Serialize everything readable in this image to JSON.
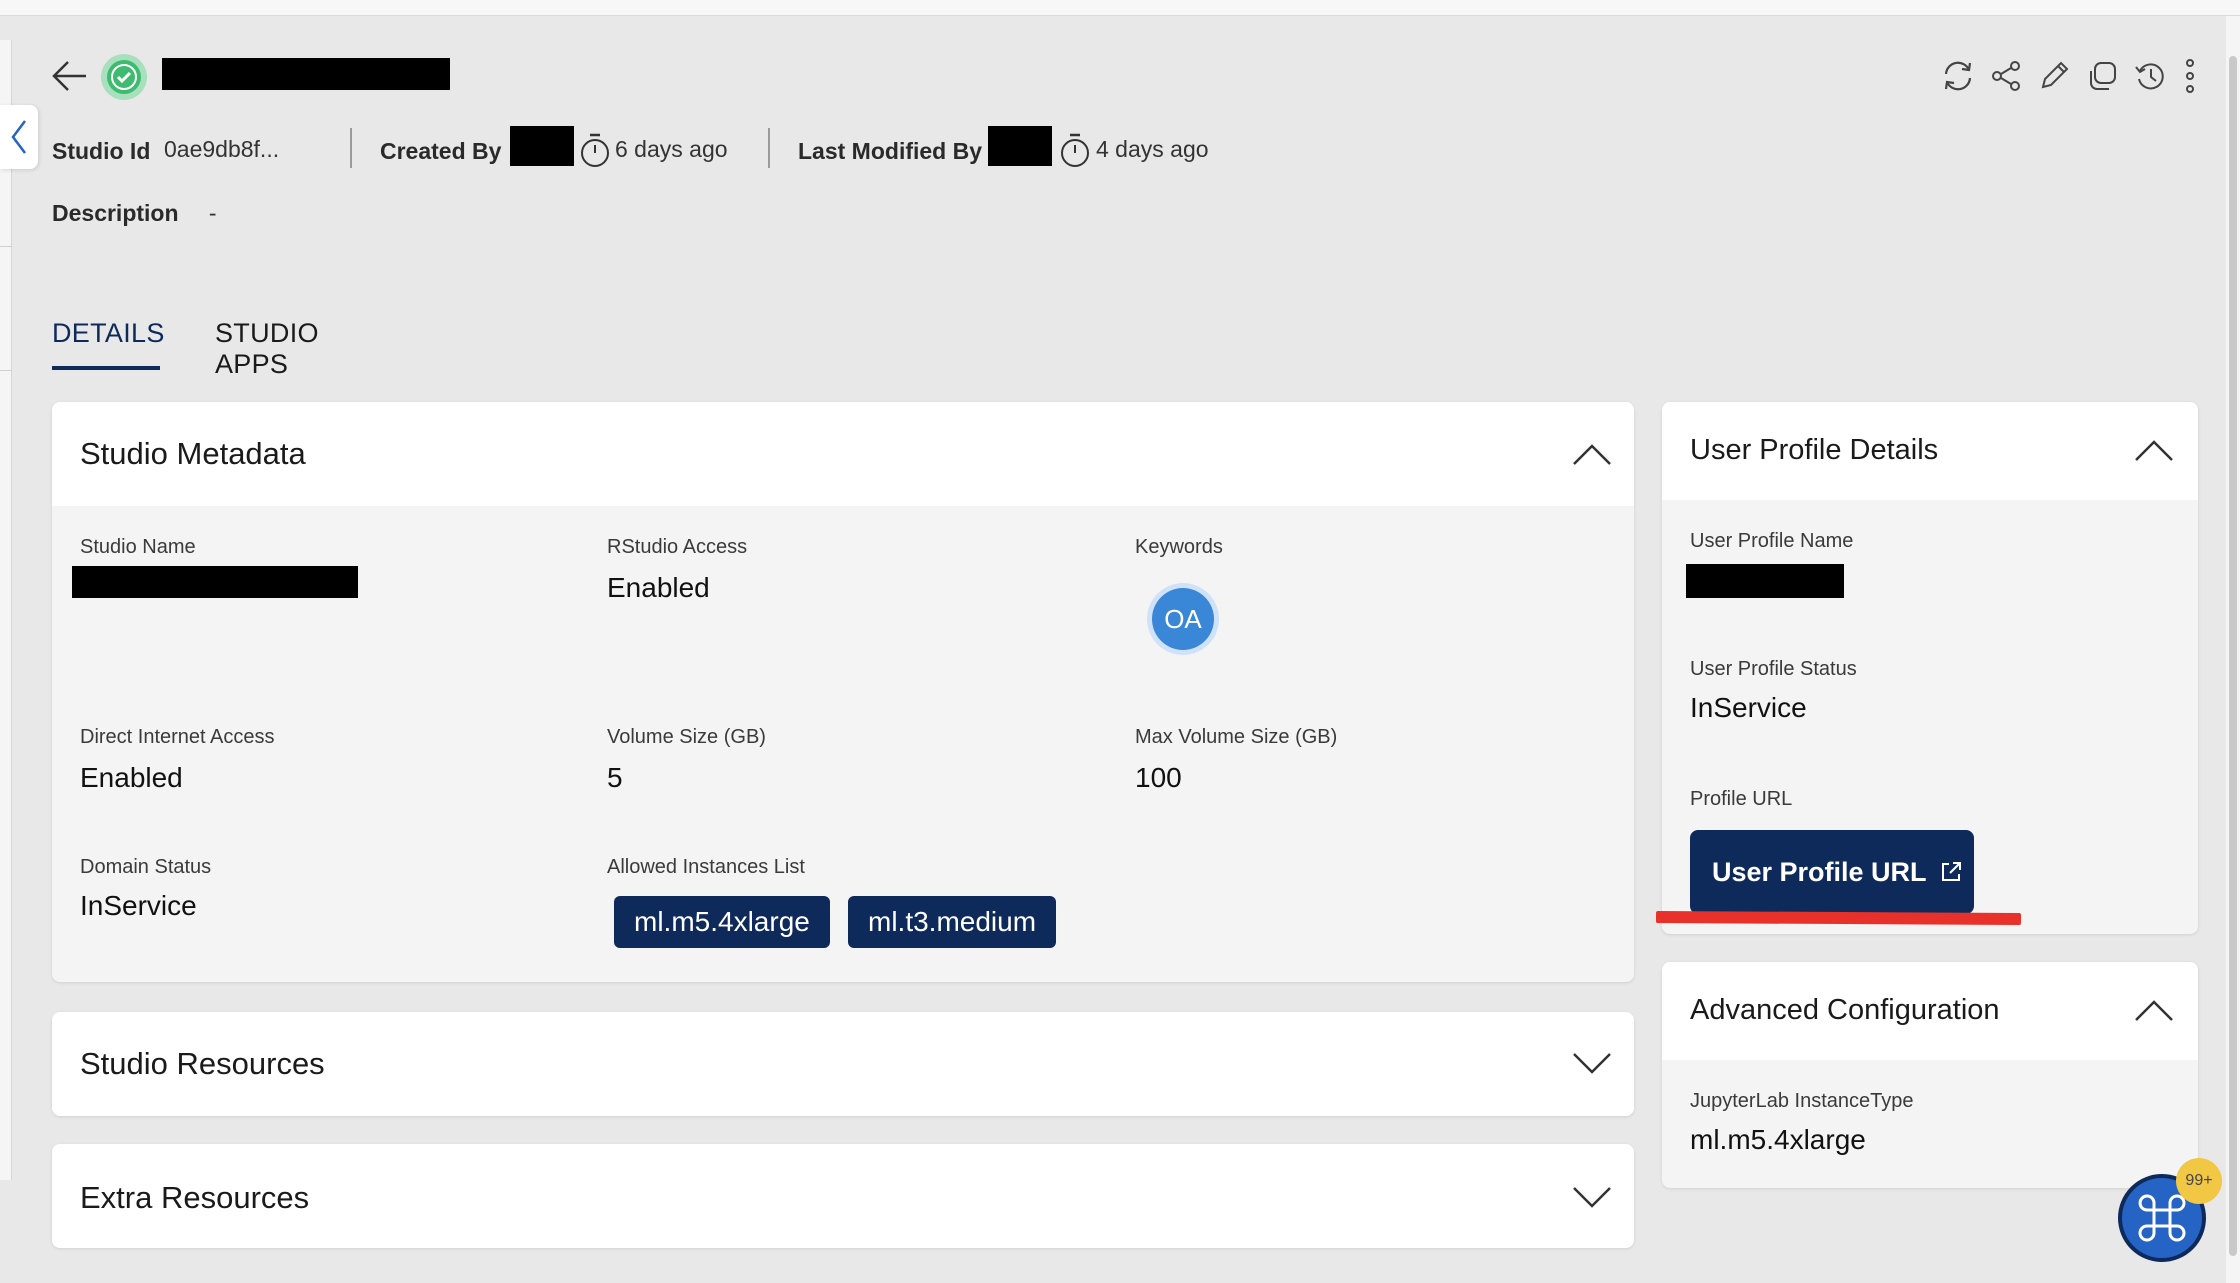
{
  "header": {
    "studio_id_label": "Studio Id",
    "studio_id_value": "0ae9db8f...",
    "created_by_label": "Created By",
    "created_time": "6 days ago",
    "modified_by_label": "Last Modified By",
    "modified_time": "4 days ago",
    "description_label": "Description",
    "description_value": "-"
  },
  "toolbar": {
    "icons": [
      "refresh-icon",
      "share-icon",
      "edit-icon",
      "clone-icon",
      "history-icon",
      "more-icon"
    ]
  },
  "tabs": [
    {
      "label": "DETAILS",
      "active": true
    },
    {
      "label": "STUDIO APPS",
      "active": false
    }
  ],
  "studio_metadata": {
    "title": "Studio Metadata",
    "studio_name_label": "Studio Name",
    "rstudio_label": "RStudio Access",
    "rstudio_value": "Enabled",
    "keywords_label": "Keywords",
    "keyword_chip": "OA",
    "internet_label": "Direct Internet Access",
    "internet_value": "Enabled",
    "volume_label": "Volume Size (GB)",
    "volume_value": "5",
    "max_volume_label": "Max Volume Size (GB)",
    "max_volume_value": "100",
    "domain_status_label": "Domain Status",
    "domain_status_value": "InService",
    "instances_label": "Allowed Instances List",
    "instances": [
      "ml.m5.4xlarge",
      "ml.t3.medium"
    ]
  },
  "studio_resources": {
    "title": "Studio Resources"
  },
  "extra_resources": {
    "title": "Extra Resources"
  },
  "user_profile": {
    "title": "User Profile Details",
    "name_label": "User Profile Name",
    "status_label": "User Profile Status",
    "status_value": "InService",
    "url_label": "Profile URL",
    "url_button": "User Profile URL"
  },
  "advanced": {
    "title": "Advanced Configuration",
    "instance_type_label": "JupyterLab InstanceType",
    "instance_type_value": "ml.m5.4xlarge"
  },
  "fab": {
    "badge": "99+"
  },
  "colors": {
    "primary": "#0e2a5a",
    "success": "#3dbb6e",
    "accent": "#e8312a"
  }
}
